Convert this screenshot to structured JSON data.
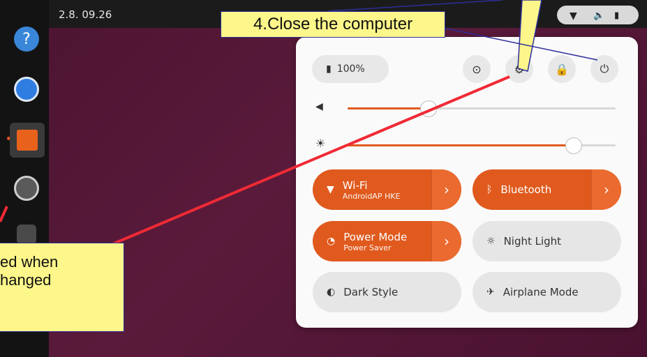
{
  "topbar": {
    "clock": "2.8. 09.26"
  },
  "quick_settings": {
    "battery_label": "100%",
    "tiles": [
      {
        "title": "Wi-Fi",
        "subtitle": "AndroidAP HKE",
        "state": "on"
      },
      {
        "title": "Bluetooth",
        "subtitle": "",
        "state": "on"
      },
      {
        "title": "Power Mode",
        "subtitle": "Power Saver",
        "state": "on"
      },
      {
        "title": "Night Light",
        "subtitle": "",
        "state": "off"
      },
      {
        "title": "Dark Style",
        "subtitle": "",
        "state": "off"
      },
      {
        "title": "Airplane Mode",
        "subtitle": "",
        "state": "off"
      }
    ],
    "volume_level": 0.3,
    "brightness_level": 0.84
  },
  "annotations": {
    "callout_top": "4.Close the computer",
    "callout_left_line1": "ed when",
    "callout_left_line2": "hanged"
  },
  "colors": {
    "accent": "#e05a1e",
    "callout_bg": "#fdf68a",
    "arrow_red": "#f02a35"
  }
}
